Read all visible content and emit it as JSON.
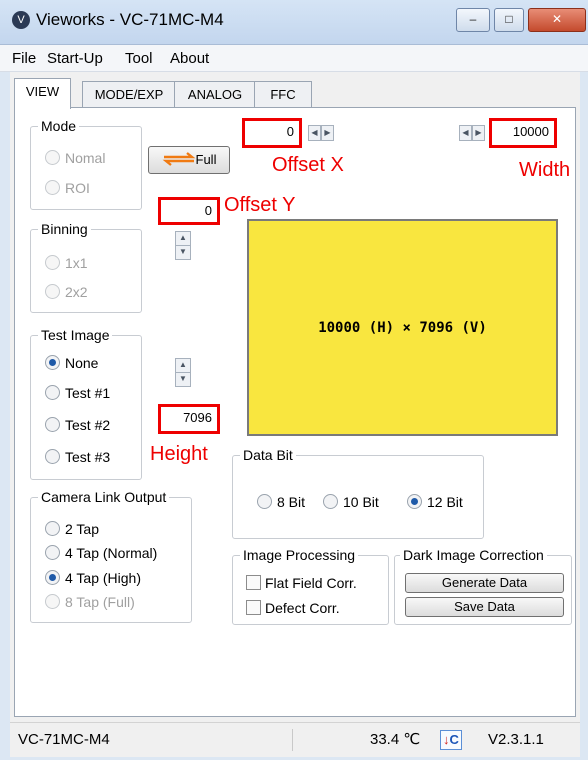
{
  "window": {
    "title": "Vieworks - VC-71MC-M4",
    "app_icon": "V",
    "minimize": "–",
    "maximize": "□",
    "close": "✕"
  },
  "menu": [
    "File",
    "Start-Up",
    "Tool",
    "About"
  ],
  "tabs": [
    "VIEW",
    "MODE/EXP",
    "ANALOG",
    "FFC"
  ],
  "mode": {
    "title": "Mode",
    "options": [
      "Nomal",
      "ROI"
    ],
    "full_button": "Full"
  },
  "binning": {
    "title": "Binning",
    "options": [
      "1x1",
      "2x2"
    ]
  },
  "test_image": {
    "title": "Test Image",
    "options": [
      "None",
      "Test #1",
      "Test #2",
      "Test #3"
    ],
    "selected": "None"
  },
  "camera_link": {
    "title": "Camera Link Output",
    "options": [
      "2 Tap",
      "4 Tap (Normal)",
      "4 Tap (High)",
      "8 Tap (Full)"
    ],
    "selected": "4 Tap (High)"
  },
  "roi": {
    "offset_x": "0",
    "offset_x_label": "Offset X",
    "width": "10000",
    "width_label": "Width",
    "offset_y": "0",
    "offset_y_label": "Offset Y",
    "height": "7096",
    "height_label": "Height",
    "preview_text": "10000 (H) × 7096 (V)",
    "preview_color": "#f9e63f"
  },
  "data_bit": {
    "title": "Data Bit",
    "options": [
      "8 Bit",
      "10 Bit",
      "12 Bit"
    ],
    "selected": "12 Bit"
  },
  "image_processing": {
    "title": "Image Processing",
    "flat_field": "Flat Field Corr.",
    "defect": "Defect Corr."
  },
  "dark_image": {
    "title": "Dark Image Correction",
    "generate": "Generate Data",
    "save": "Save Data"
  },
  "status": {
    "model": "VC-71MC-M4",
    "temperature": "33.4 ℃",
    "version": "V2.3.1.1",
    "temp_icon": "C"
  },
  "colors": {
    "highlight_red": "#e00000",
    "selected_radio": "#1f5aa8"
  }
}
